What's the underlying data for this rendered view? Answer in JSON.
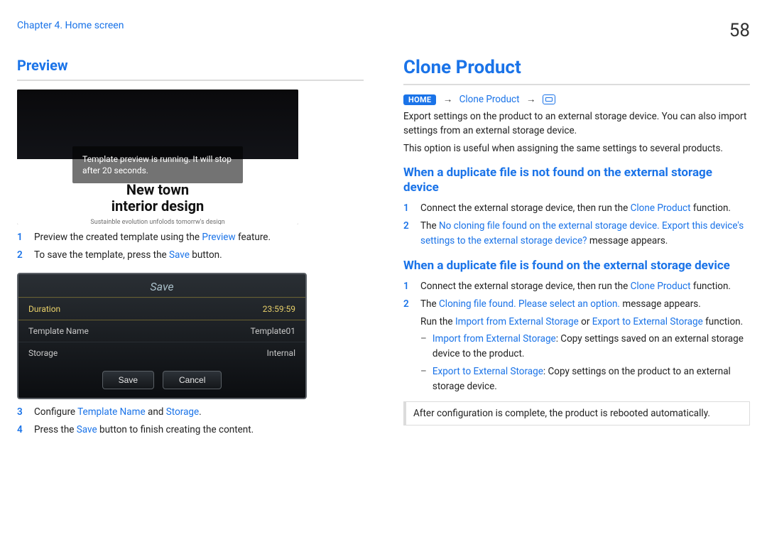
{
  "header": {
    "crumb": "Chapter 4. Home screen",
    "page_number": "58"
  },
  "left": {
    "section_title": "Preview",
    "tv_msg": "Template preview is running. It will stop after 20 seconds.",
    "tv_title1": "New town",
    "tv_title2": "interior design",
    "tv_sub": "Sustainble evolution unfolods tomorrw's design",
    "steps1": [
      {
        "n": "1",
        "pre": "Preview the created template using the ",
        "ui": "Preview",
        "post": " feature."
      },
      {
        "n": "2",
        "pre": "To save the template, press the ",
        "ui": "Save",
        "post": " button."
      }
    ],
    "save_title": "Save",
    "rows": [
      {
        "k": "Duration",
        "v": "23:59:59",
        "sel": true
      },
      {
        "k": "Template Name",
        "v": "Template01",
        "sel": false
      },
      {
        "k": "Storage",
        "v": "Internal",
        "sel": false
      }
    ],
    "buttons": {
      "save": "Save",
      "cancel": "Cancel"
    },
    "steps2": [
      {
        "n": "3",
        "pre": "Configure ",
        "ui": "Template Name",
        "mid": " and ",
        "ui2": "Storage",
        "post": "."
      },
      {
        "n": "4",
        "pre": "Press the ",
        "ui": "Save",
        "post": " button to finish creating the content."
      }
    ]
  },
  "right": {
    "section_title": "Clone Product",
    "nav_home": "HOME",
    "nav_item": "Clone Product",
    "intro1": "Export settings on the product to an external storage device. You can also import settings from an external storage device.",
    "intro2": "This option is useful when assigning the same settings to several products.",
    "sub1": "When a duplicate file is not found on the external storage device",
    "s1_steps": [
      {
        "n": "1",
        "pre": "Connect the external storage device, then run the ",
        "ui": "Clone Product",
        "post": " function."
      },
      {
        "n": "2",
        "pre": "The ",
        "ui": "No cloning file found on the external storage device. Export this device's settings to the external storage device?",
        "post": " message appears."
      }
    ],
    "sub2": "When a duplicate file is found on the external storage device",
    "s2_steps": [
      {
        "n": "1",
        "pre": "Connect the external storage device, then run the ",
        "ui": "Clone Product",
        "post": " function."
      },
      {
        "n": "2",
        "pre": "The ",
        "ui": "Cloning file found. Please select an option.",
        "post": " message appears."
      }
    ],
    "run_line": {
      "pre": "Run the ",
      "a": "Import from External Storage",
      "mid": " or ",
      "b": "Export to External Storage",
      "post": " function."
    },
    "dash": [
      {
        "ui": "Import from External Storage",
        "txt": ": Copy settings saved on an external storage device to the product."
      },
      {
        "ui": "Export to External Storage",
        "txt": ": Copy settings on the product to an external storage device."
      }
    ],
    "note": "After configuration is complete, the product is rebooted automatically."
  }
}
